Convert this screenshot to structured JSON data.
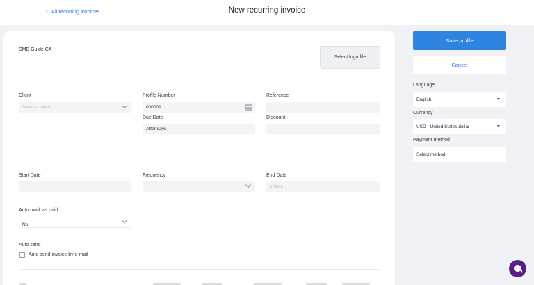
{
  "header": {
    "back_label": "All recurring invoices",
    "title": "New recurring invoice"
  },
  "company": {
    "name": "SMB Guide CA",
    "logo_button": "Select logo file"
  },
  "form": {
    "client": {
      "label": "Client",
      "placeholder": "Select a client"
    },
    "profile_number": {
      "label": "Profile Number",
      "value": "000001"
    },
    "reference": {
      "label": "Reference",
      "value": ""
    },
    "due_date": {
      "label": "Due Date",
      "value": "After  days"
    },
    "discount": {
      "label": "Discount",
      "value": ""
    },
    "start_date": {
      "label": "Start Date",
      "value": ""
    },
    "frequency": {
      "label": "Frequency",
      "value": ""
    },
    "end_date": {
      "label": "End Date",
      "placeholder": "Infinite"
    },
    "auto_mark_paid": {
      "label": "Auto mark as paid",
      "value": "No"
    },
    "auto_send": {
      "label": "Auto send",
      "checkbox_label": "Auto send invoice by e-mail"
    }
  },
  "sidebar": {
    "save_label": "Save profile",
    "cancel_label": "Cancel",
    "language": {
      "label": "Language",
      "value": "English"
    },
    "currency": {
      "label": "Currency",
      "value": "USD - United States dollar"
    },
    "payment_method": {
      "label": "Payment method",
      "value": "Select method"
    }
  },
  "colors": {
    "primary": "#2e84e0",
    "link": "#2f7ad6",
    "chat": "#5a1f86",
    "background": "#f1f2f5"
  },
  "icons": [
    "chevron-left-icon",
    "chevron-down-icon",
    "calendar-icon",
    "caret-down-icon",
    "chat-icon"
  ]
}
